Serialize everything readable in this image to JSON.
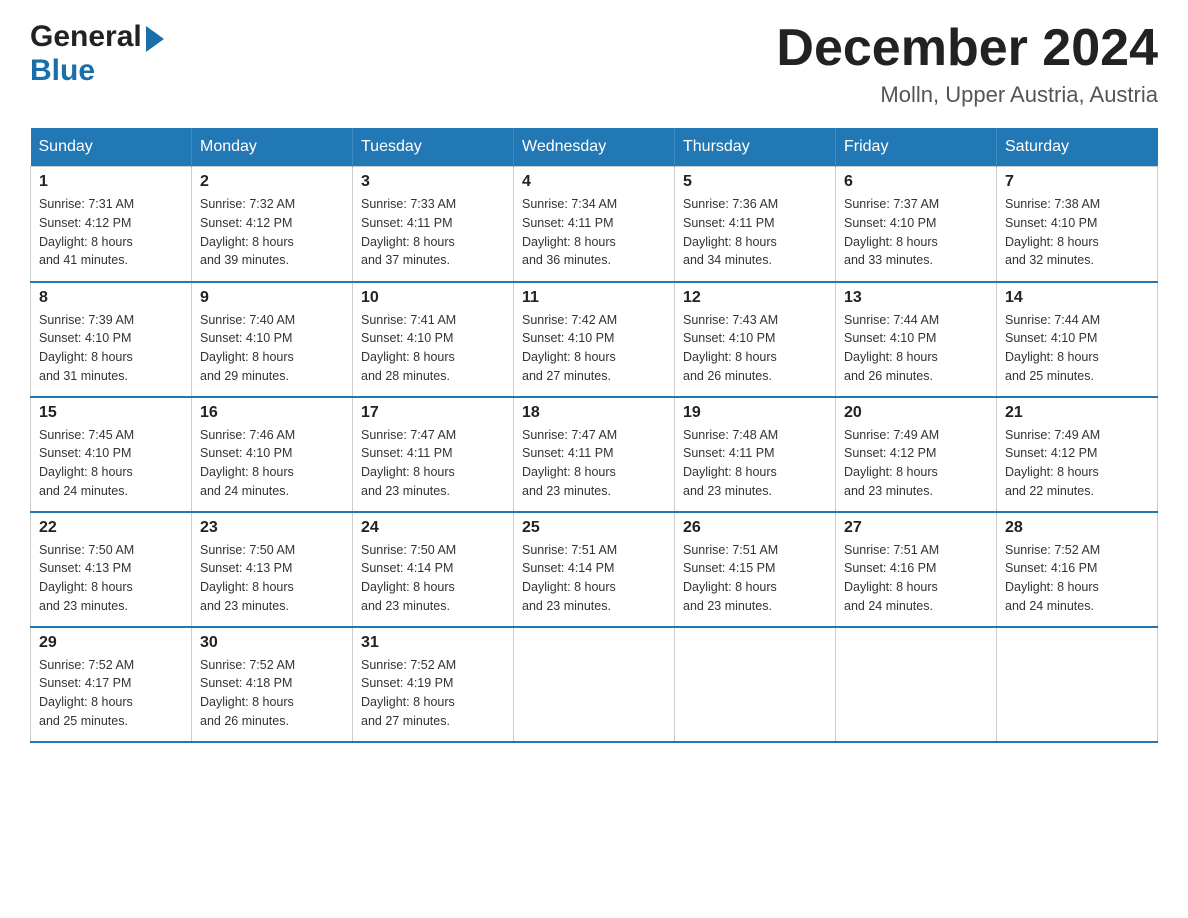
{
  "header": {
    "logo": {
      "general": "General",
      "blue": "Blue"
    },
    "title": "December 2024",
    "location": "Molln, Upper Austria, Austria"
  },
  "days_of_week": [
    "Sunday",
    "Monday",
    "Tuesday",
    "Wednesday",
    "Thursday",
    "Friday",
    "Saturday"
  ],
  "weeks": [
    [
      {
        "day": "1",
        "sunrise": "7:31 AM",
        "sunset": "4:12 PM",
        "daylight": "8 hours and 41 minutes."
      },
      {
        "day": "2",
        "sunrise": "7:32 AM",
        "sunset": "4:12 PM",
        "daylight": "8 hours and 39 minutes."
      },
      {
        "day": "3",
        "sunrise": "7:33 AM",
        "sunset": "4:11 PM",
        "daylight": "8 hours and 37 minutes."
      },
      {
        "day": "4",
        "sunrise": "7:34 AM",
        "sunset": "4:11 PM",
        "daylight": "8 hours and 36 minutes."
      },
      {
        "day": "5",
        "sunrise": "7:36 AM",
        "sunset": "4:11 PM",
        "daylight": "8 hours and 34 minutes."
      },
      {
        "day": "6",
        "sunrise": "7:37 AM",
        "sunset": "4:10 PM",
        "daylight": "8 hours and 33 minutes."
      },
      {
        "day": "7",
        "sunrise": "7:38 AM",
        "sunset": "4:10 PM",
        "daylight": "8 hours and 32 minutes."
      }
    ],
    [
      {
        "day": "8",
        "sunrise": "7:39 AM",
        "sunset": "4:10 PM",
        "daylight": "8 hours and 31 minutes."
      },
      {
        "day": "9",
        "sunrise": "7:40 AM",
        "sunset": "4:10 PM",
        "daylight": "8 hours and 29 minutes."
      },
      {
        "day": "10",
        "sunrise": "7:41 AM",
        "sunset": "4:10 PM",
        "daylight": "8 hours and 28 minutes."
      },
      {
        "day": "11",
        "sunrise": "7:42 AM",
        "sunset": "4:10 PM",
        "daylight": "8 hours and 27 minutes."
      },
      {
        "day": "12",
        "sunrise": "7:43 AM",
        "sunset": "4:10 PM",
        "daylight": "8 hours and 26 minutes."
      },
      {
        "day": "13",
        "sunrise": "7:44 AM",
        "sunset": "4:10 PM",
        "daylight": "8 hours and 26 minutes."
      },
      {
        "day": "14",
        "sunrise": "7:44 AM",
        "sunset": "4:10 PM",
        "daylight": "8 hours and 25 minutes."
      }
    ],
    [
      {
        "day": "15",
        "sunrise": "7:45 AM",
        "sunset": "4:10 PM",
        "daylight": "8 hours and 24 minutes."
      },
      {
        "day": "16",
        "sunrise": "7:46 AM",
        "sunset": "4:10 PM",
        "daylight": "8 hours and 24 minutes."
      },
      {
        "day": "17",
        "sunrise": "7:47 AM",
        "sunset": "4:11 PM",
        "daylight": "8 hours and 23 minutes."
      },
      {
        "day": "18",
        "sunrise": "7:47 AM",
        "sunset": "4:11 PM",
        "daylight": "8 hours and 23 minutes."
      },
      {
        "day": "19",
        "sunrise": "7:48 AM",
        "sunset": "4:11 PM",
        "daylight": "8 hours and 23 minutes."
      },
      {
        "day": "20",
        "sunrise": "7:49 AM",
        "sunset": "4:12 PM",
        "daylight": "8 hours and 23 minutes."
      },
      {
        "day": "21",
        "sunrise": "7:49 AM",
        "sunset": "4:12 PM",
        "daylight": "8 hours and 22 minutes."
      }
    ],
    [
      {
        "day": "22",
        "sunrise": "7:50 AM",
        "sunset": "4:13 PM",
        "daylight": "8 hours and 23 minutes."
      },
      {
        "day": "23",
        "sunrise": "7:50 AM",
        "sunset": "4:13 PM",
        "daylight": "8 hours and 23 minutes."
      },
      {
        "day": "24",
        "sunrise": "7:50 AM",
        "sunset": "4:14 PM",
        "daylight": "8 hours and 23 minutes."
      },
      {
        "day": "25",
        "sunrise": "7:51 AM",
        "sunset": "4:14 PM",
        "daylight": "8 hours and 23 minutes."
      },
      {
        "day": "26",
        "sunrise": "7:51 AM",
        "sunset": "4:15 PM",
        "daylight": "8 hours and 23 minutes."
      },
      {
        "day": "27",
        "sunrise": "7:51 AM",
        "sunset": "4:16 PM",
        "daylight": "8 hours and 24 minutes."
      },
      {
        "day": "28",
        "sunrise": "7:52 AM",
        "sunset": "4:16 PM",
        "daylight": "8 hours and 24 minutes."
      }
    ],
    [
      {
        "day": "29",
        "sunrise": "7:52 AM",
        "sunset": "4:17 PM",
        "daylight": "8 hours and 25 minutes."
      },
      {
        "day": "30",
        "sunrise": "7:52 AM",
        "sunset": "4:18 PM",
        "daylight": "8 hours and 26 minutes."
      },
      {
        "day": "31",
        "sunrise": "7:52 AM",
        "sunset": "4:19 PM",
        "daylight": "8 hours and 27 minutes."
      },
      null,
      null,
      null,
      null
    ]
  ],
  "labels": {
    "sunrise": "Sunrise:",
    "sunset": "Sunset:",
    "daylight": "Daylight:"
  }
}
